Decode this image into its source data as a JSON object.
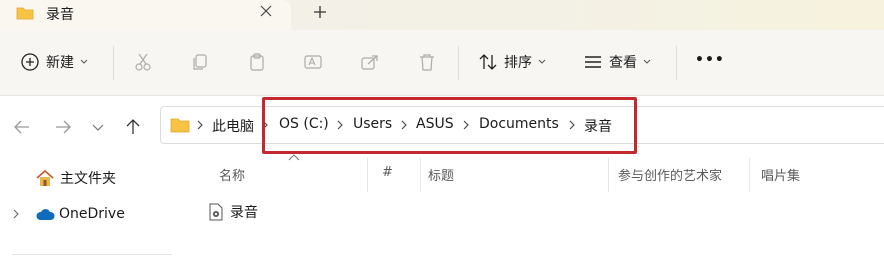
{
  "tab": {
    "title": "录音",
    "icon": "folder-icon"
  },
  "toolbar": {
    "new_label": "新建",
    "sort_label": "排序",
    "view_label": "查看",
    "more_label": "•••"
  },
  "breadcrumbs": [
    "此电脑",
    "OS (C:)",
    "Users",
    "ASUS",
    "Documents",
    "录音"
  ],
  "sidebar": {
    "items": [
      {
        "label": "主文件夹",
        "icon": "home-icon"
      },
      {
        "label": "OneDrive",
        "icon": "cloud-icon"
      }
    ]
  },
  "columns": [
    "名称",
    "#",
    "标题",
    "参与创作的艺术家",
    "唱片集"
  ],
  "files": [
    {
      "name": "录音",
      "icon": "audio-file-icon"
    }
  ],
  "colors": {
    "highlight": "#c4292f",
    "folder": "#f6c344",
    "onedrive": "#0f6cbd"
  }
}
